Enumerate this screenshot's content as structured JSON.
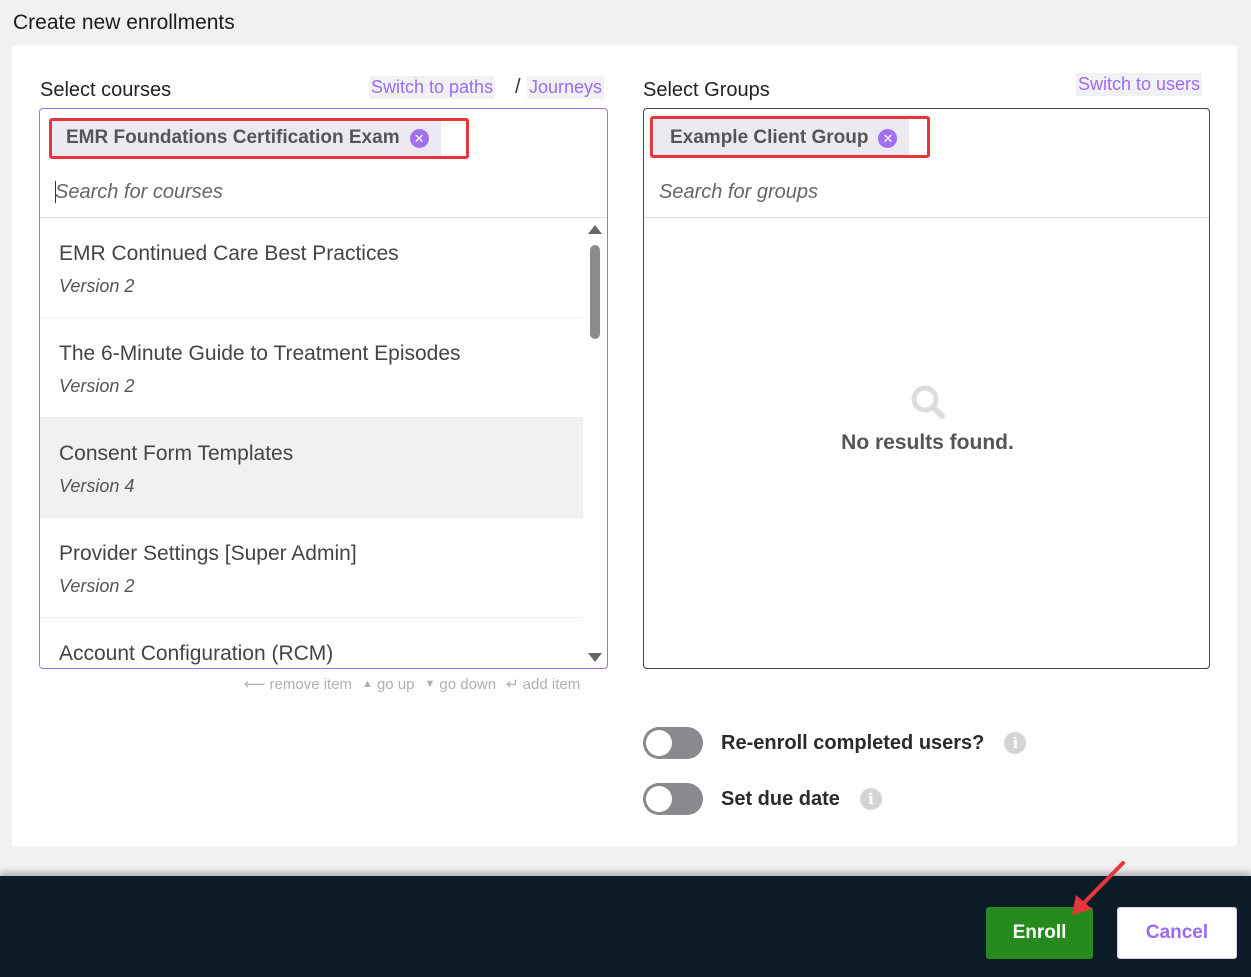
{
  "page": {
    "title": "Create new enrollments"
  },
  "courses": {
    "label": "Select courses",
    "switch_paths": "Switch to paths",
    "separator": "/",
    "switch_journeys": "Journeys",
    "selected_chip": "EMR Foundations Certification Exam",
    "search_placeholder": "Search for courses",
    "items": [
      {
        "title": "EMR Continued Care Best Practices",
        "version": "Version 2"
      },
      {
        "title": "The 6-Minute Guide to Treatment Episodes",
        "version": "Version 2"
      },
      {
        "title": "Consent Form Templates",
        "version": "Version 4"
      },
      {
        "title": "Provider Settings [Super Admin]",
        "version": "Version 2"
      },
      {
        "title": "Account Configuration (RCM)",
        "version": ""
      }
    ],
    "hints": {
      "remove": "remove item",
      "up": "go up",
      "down": "go down",
      "add": "add item"
    }
  },
  "groups": {
    "label": "Select Groups",
    "switch_users": "Switch to users",
    "selected_chip": "Example Client Group",
    "search_placeholder": "Search for groups",
    "empty_text": "No results found."
  },
  "options": {
    "reenroll_label": "Re-enroll completed users?",
    "due_date_label": "Set due date"
  },
  "footer": {
    "enroll_label": "Enroll",
    "cancel_label": "Cancel"
  },
  "colors": {
    "accent": "#9b6cf0",
    "enroll": "#268a1e",
    "footer_bg": "#0b1b28",
    "highlight": "#e5373b"
  }
}
